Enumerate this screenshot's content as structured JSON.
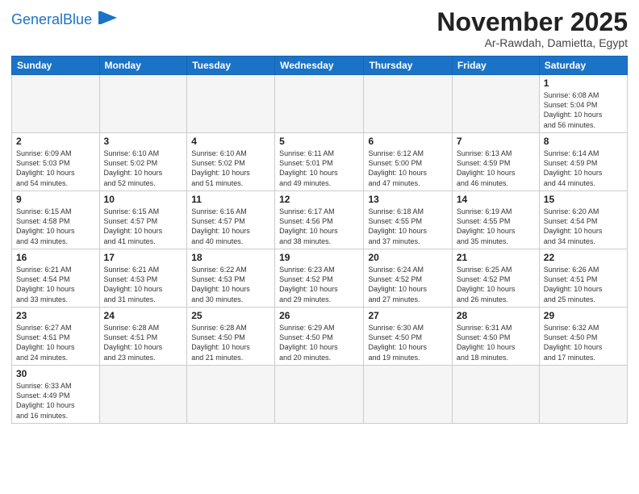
{
  "logo": {
    "text_general": "General",
    "text_blue": "Blue"
  },
  "title": "November 2025",
  "location": "Ar-Rawdah, Damietta, Egypt",
  "weekdays": [
    "Sunday",
    "Monday",
    "Tuesday",
    "Wednesday",
    "Thursday",
    "Friday",
    "Saturday"
  ],
  "days": {
    "1": {
      "sunrise": "6:08 AM",
      "sunset": "5:04 PM",
      "daylight": "10 hours and 56 minutes."
    },
    "2": {
      "sunrise": "6:09 AM",
      "sunset": "5:03 PM",
      "daylight": "10 hours and 54 minutes."
    },
    "3": {
      "sunrise": "6:10 AM",
      "sunset": "5:02 PM",
      "daylight": "10 hours and 52 minutes."
    },
    "4": {
      "sunrise": "6:10 AM",
      "sunset": "5:02 PM",
      "daylight": "10 hours and 51 minutes."
    },
    "5": {
      "sunrise": "6:11 AM",
      "sunset": "5:01 PM",
      "daylight": "10 hours and 49 minutes."
    },
    "6": {
      "sunrise": "6:12 AM",
      "sunset": "5:00 PM",
      "daylight": "10 hours and 47 minutes."
    },
    "7": {
      "sunrise": "6:13 AM",
      "sunset": "4:59 PM",
      "daylight": "10 hours and 46 minutes."
    },
    "8": {
      "sunrise": "6:14 AM",
      "sunset": "4:59 PM",
      "daylight": "10 hours and 44 minutes."
    },
    "9": {
      "sunrise": "6:15 AM",
      "sunset": "4:58 PM",
      "daylight": "10 hours and 43 minutes."
    },
    "10": {
      "sunrise": "6:15 AM",
      "sunset": "4:57 PM",
      "daylight": "10 hours and 41 minutes."
    },
    "11": {
      "sunrise": "6:16 AM",
      "sunset": "4:57 PM",
      "daylight": "10 hours and 40 minutes."
    },
    "12": {
      "sunrise": "6:17 AM",
      "sunset": "4:56 PM",
      "daylight": "10 hours and 38 minutes."
    },
    "13": {
      "sunrise": "6:18 AM",
      "sunset": "4:55 PM",
      "daylight": "10 hours and 37 minutes."
    },
    "14": {
      "sunrise": "6:19 AM",
      "sunset": "4:55 PM",
      "daylight": "10 hours and 35 minutes."
    },
    "15": {
      "sunrise": "6:20 AM",
      "sunset": "4:54 PM",
      "daylight": "10 hours and 34 minutes."
    },
    "16": {
      "sunrise": "6:21 AM",
      "sunset": "4:54 PM",
      "daylight": "10 hours and 33 minutes."
    },
    "17": {
      "sunrise": "6:21 AM",
      "sunset": "4:53 PM",
      "daylight": "10 hours and 31 minutes."
    },
    "18": {
      "sunrise": "6:22 AM",
      "sunset": "4:53 PM",
      "daylight": "10 hours and 30 minutes."
    },
    "19": {
      "sunrise": "6:23 AM",
      "sunset": "4:52 PM",
      "daylight": "10 hours and 29 minutes."
    },
    "20": {
      "sunrise": "6:24 AM",
      "sunset": "4:52 PM",
      "daylight": "10 hours and 27 minutes."
    },
    "21": {
      "sunrise": "6:25 AM",
      "sunset": "4:52 PM",
      "daylight": "10 hours and 26 minutes."
    },
    "22": {
      "sunrise": "6:26 AM",
      "sunset": "4:51 PM",
      "daylight": "10 hours and 25 minutes."
    },
    "23": {
      "sunrise": "6:27 AM",
      "sunset": "4:51 PM",
      "daylight": "10 hours and 24 minutes."
    },
    "24": {
      "sunrise": "6:28 AM",
      "sunset": "4:51 PM",
      "daylight": "10 hours and 23 minutes."
    },
    "25": {
      "sunrise": "6:28 AM",
      "sunset": "4:50 PM",
      "daylight": "10 hours and 21 minutes."
    },
    "26": {
      "sunrise": "6:29 AM",
      "sunset": "4:50 PM",
      "daylight": "10 hours and 20 minutes."
    },
    "27": {
      "sunrise": "6:30 AM",
      "sunset": "4:50 PM",
      "daylight": "10 hours and 19 minutes."
    },
    "28": {
      "sunrise": "6:31 AM",
      "sunset": "4:50 PM",
      "daylight": "10 hours and 18 minutes."
    },
    "29": {
      "sunrise": "6:32 AM",
      "sunset": "4:50 PM",
      "daylight": "10 hours and 17 minutes."
    },
    "30": {
      "sunrise": "6:33 AM",
      "sunset": "4:49 PM",
      "daylight": "10 hours and 16 minutes."
    }
  }
}
